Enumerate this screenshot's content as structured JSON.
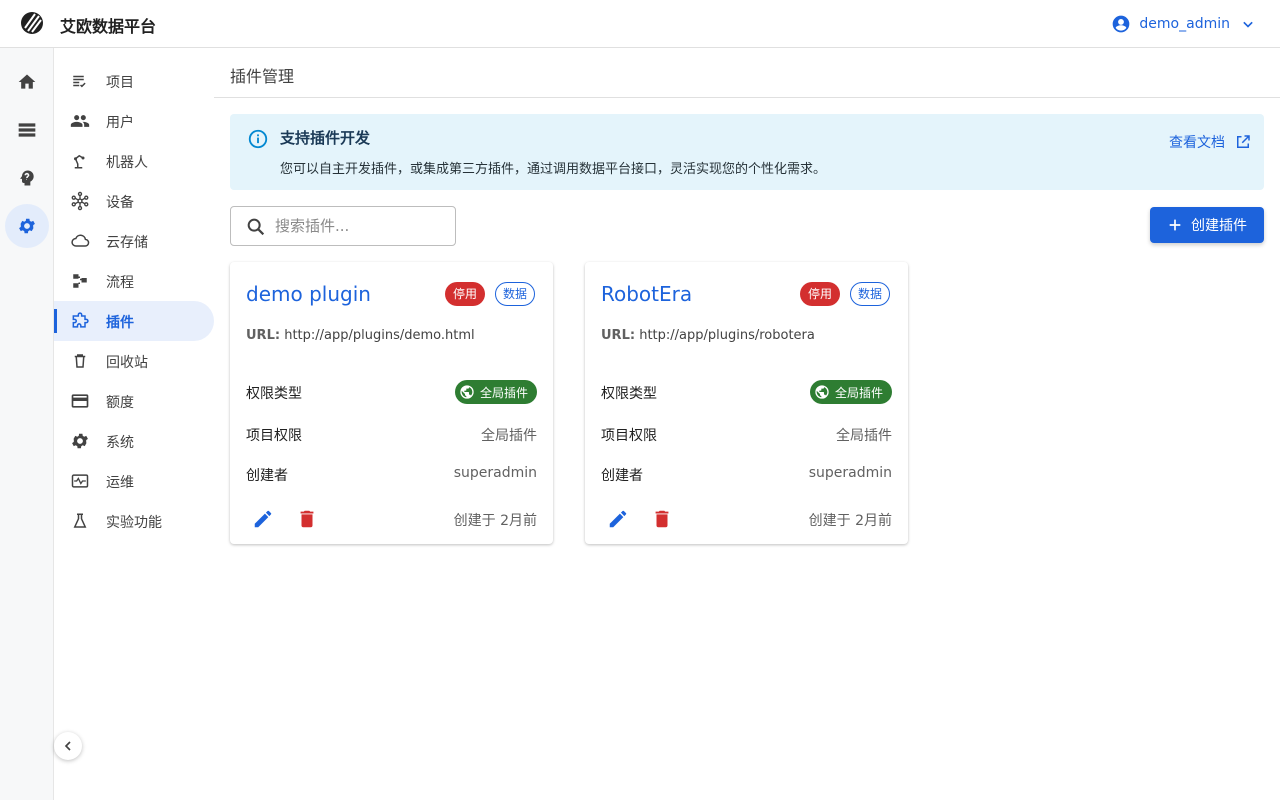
{
  "app": {
    "title": "艾欧数据平台",
    "user": "demo_admin"
  },
  "rail": [
    {
      "icon": "home-icon"
    },
    {
      "icon": "storage-icon"
    },
    {
      "icon": "psychology-icon"
    },
    {
      "icon": "settings-icon",
      "active": true
    }
  ],
  "nav": {
    "items": [
      {
        "label": "项目",
        "icon": "project-list-icon"
      },
      {
        "label": "用户",
        "icon": "people-icon"
      },
      {
        "label": "机器人",
        "icon": "robot-arm-icon"
      },
      {
        "label": "设备",
        "icon": "device-hub-icon"
      },
      {
        "label": "云存储",
        "icon": "cloud-icon"
      },
      {
        "label": "流程",
        "icon": "workflow-icon"
      },
      {
        "label": "插件",
        "icon": "extension-icon",
        "active": true
      },
      {
        "label": "回收站",
        "icon": "trash-icon"
      },
      {
        "label": "额度",
        "icon": "credit-card-icon"
      },
      {
        "label": "系统",
        "icon": "settings-icon"
      },
      {
        "label": "运维",
        "icon": "monitoring-icon"
      },
      {
        "label": "实验功能",
        "icon": "flask-icon"
      }
    ]
  },
  "page": {
    "title": "插件管理"
  },
  "alert": {
    "title": "支持插件开发",
    "description": "您可以自主开发插件，或集成第三方插件，通过调用数据平台接口，灵活实现您的个性化需求。",
    "link": "查看文档"
  },
  "search": {
    "placeholder": "搜索插件..."
  },
  "create_button": "创建插件",
  "labels": {
    "url": "URL:",
    "permission_type": "权限类型",
    "project_permission": "项目权限",
    "creator": "创建者"
  },
  "plugins": [
    {
      "name": "demo plugin",
      "status_badge": "停用",
      "type_badge": "数据",
      "url": "http://app/plugins/demo.html",
      "permission_type": "全局插件",
      "project_permission": "全局插件",
      "creator": "superadmin",
      "created": "创建于 2月前"
    },
    {
      "name": "RobotEra",
      "status_badge": "停用",
      "type_badge": "数据",
      "url": "http://app/plugins/robotera",
      "permission_type": "全局插件",
      "project_permission": "全局插件",
      "creator": "superadmin",
      "created": "创建于 2月前"
    }
  ],
  "colors": {
    "primary": "#1d63dc",
    "danger": "#d32f2f",
    "success": "#2e7d32",
    "info_bg": "#e4f4fb"
  }
}
